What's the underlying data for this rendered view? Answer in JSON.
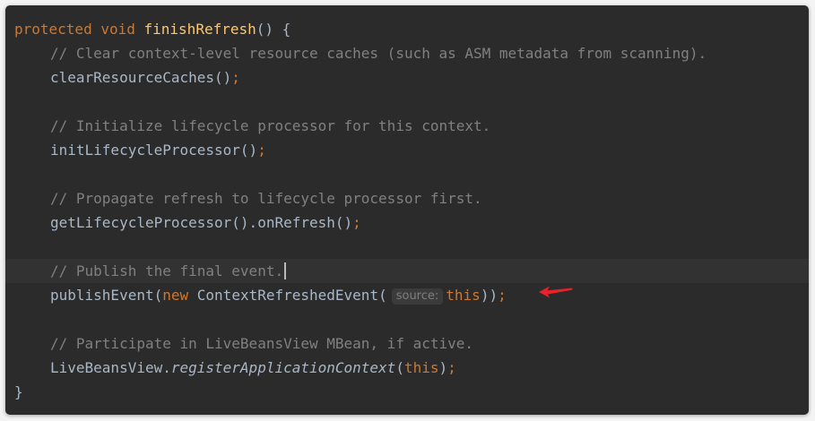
{
  "editor": {
    "colors": {
      "background": "#2b2b2b",
      "keyword": "#cc7832",
      "method_declaration": "#ffc66d",
      "comment": "#808080",
      "identifier": "#a9b7c6",
      "annotation_arrow": "#e8212b"
    },
    "code": {
      "signature": {
        "modifier_protected": "protected",
        "modifier_void": "void",
        "method_name": "finishRefresh",
        "params_open": "() {"
      },
      "comment1": "// Clear context-level resource caches (such as ASM metadata from scanning).",
      "call1": {
        "name": "clearResourceCaches",
        "parens": "()",
        "semi": ";"
      },
      "comment2": "// Initialize lifecycle processor for this context.",
      "call2": {
        "name": "initLifecycleProcessor",
        "parens": "()",
        "semi": ";"
      },
      "comment3": "// Propagate refresh to lifecycle processor first.",
      "call3": {
        "name": "getLifecycleProcessor().onRefresh",
        "parens": "()",
        "semi": ";"
      },
      "comment4": "// Publish the final event.",
      "call4": {
        "name": "publishEvent",
        "open": "(",
        "new_kw": "new",
        "class_name": "ContextRefreshedEvent",
        "open2": "(",
        "hint": "source:",
        "arg": "this",
        "close": "))",
        "semi": ";"
      },
      "comment5": "// Participate in LiveBeansView MBean, if active.",
      "call5": {
        "object": "LiveBeansView.",
        "static_method": "registerApplicationContext",
        "open": "(",
        "arg": "this",
        "close": ")",
        "semi": ";"
      },
      "closing_brace": "}"
    }
  }
}
